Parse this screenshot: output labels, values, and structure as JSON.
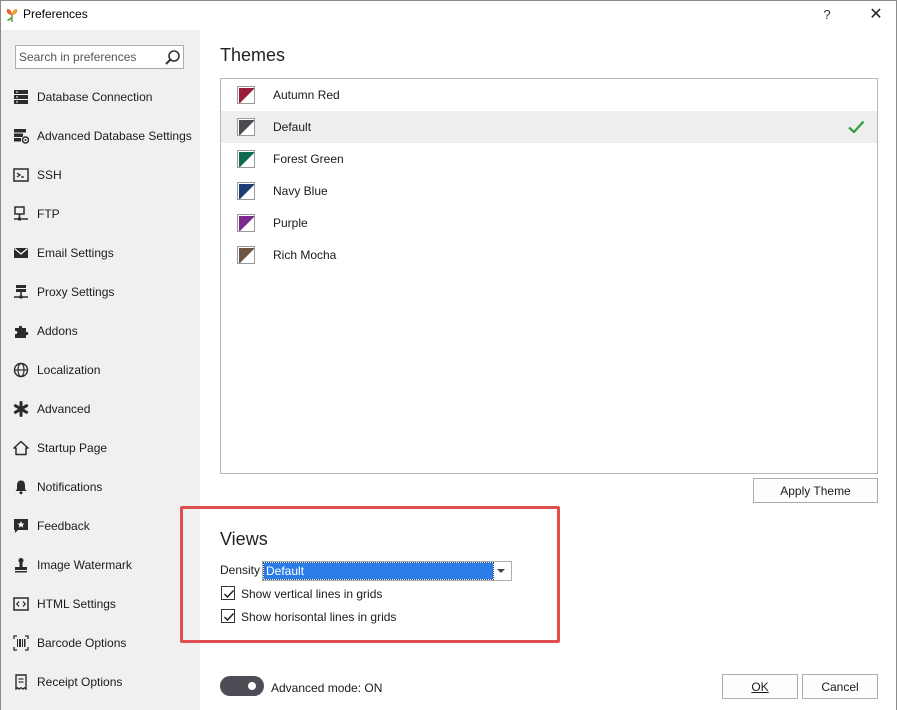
{
  "window": {
    "title": "Preferences",
    "help_label": "?",
    "close_label": "✕"
  },
  "search": {
    "placeholder": "Search in preferences",
    "value": ""
  },
  "sidebar": {
    "items": [
      {
        "label": "Database Connection",
        "icon": "database-icon"
      },
      {
        "label": "Advanced Database Settings",
        "icon": "database-settings-icon"
      },
      {
        "label": "SSH",
        "icon": "terminal-icon"
      },
      {
        "label": "FTP",
        "icon": "network-icon"
      },
      {
        "label": "Email Settings",
        "icon": "envelope-icon"
      },
      {
        "label": "Proxy Settings",
        "icon": "server-icon"
      },
      {
        "label": "Addons",
        "icon": "puzzle-icon"
      },
      {
        "label": "Localization",
        "icon": "globe-icon"
      },
      {
        "label": "Advanced",
        "icon": "asterisk-icon"
      },
      {
        "label": "Startup Page",
        "icon": "home-icon"
      },
      {
        "label": "Notifications",
        "icon": "bell-icon"
      },
      {
        "label": "Feedback",
        "icon": "star-comment-icon"
      },
      {
        "label": "Image Watermark",
        "icon": "stamp-icon"
      },
      {
        "label": "HTML Settings",
        "icon": "code-icon"
      },
      {
        "label": "Barcode Options",
        "icon": "barcode-icon"
      },
      {
        "label": "Receipt Options",
        "icon": "receipt-icon"
      }
    ]
  },
  "themes": {
    "title": "Themes",
    "selected": "Default",
    "items": [
      {
        "label": "Autumn Red",
        "color": "#9b1d3c"
      },
      {
        "label": "Default",
        "color": "#4b4b52"
      },
      {
        "label": "Forest Green",
        "color": "#0f6b4f"
      },
      {
        "label": "Navy Blue",
        "color": "#1d3f74"
      },
      {
        "label": "Purple",
        "color": "#7a2a8f"
      },
      {
        "label": "Rich Mocha",
        "color": "#6e5644"
      }
    ],
    "apply_label": "Apply Theme"
  },
  "views": {
    "title": "Views",
    "density_label": "Density",
    "density_value": "Default",
    "show_vertical_label": "Show vertical lines in grids",
    "show_vertical_checked": true,
    "show_horizontal_label": "Show horisontal lines in grids",
    "show_horizontal_checked": true
  },
  "footer": {
    "advanced_mode_label": "Advanced mode: ON",
    "advanced_mode_on": true,
    "ok_label": "OK",
    "cancel_label": "Cancel"
  },
  "colors": {
    "accent_check": "#2e9e3e",
    "highlight_border": "#e0504f",
    "selection_blue": "#2d7de8"
  }
}
